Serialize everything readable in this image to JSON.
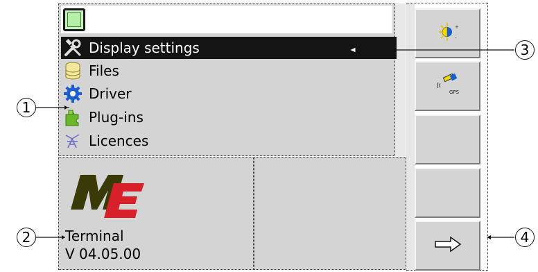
{
  "menu": {
    "items": [
      {
        "label": "Display settings",
        "icon": "tools-icon",
        "selected": true
      },
      {
        "label": "Files",
        "icon": "database-icon",
        "selected": false
      },
      {
        "label": "Driver",
        "icon": "gear-icon",
        "selected": false
      },
      {
        "label": "Plug-ins",
        "icon": "puzzle-icon",
        "selected": false
      },
      {
        "label": "Licences",
        "icon": "license-icon",
        "selected": false
      }
    ]
  },
  "info": {
    "logo_text": "ME",
    "terminal_label": "Terminal",
    "version": "V 04.05.00"
  },
  "softkeys": [
    {
      "icon": "brightness-icon"
    },
    {
      "icon": "gps-icon",
      "label": "GPS"
    },
    {
      "icon": ""
    },
    {
      "icon": ""
    },
    {
      "icon": "arrow-right-icon"
    }
  ],
  "callouts": [
    "1",
    "2",
    "3",
    "4"
  ],
  "colors": {
    "panel": "#d4d4d4",
    "selected": "#141414",
    "logo_dark": "#3a3a08",
    "logo_red": "#d8202a",
    "gps_yellow": "#f0d800",
    "gear_blue": "#1a5fd0",
    "puzzle_green": "#6ab82a"
  }
}
